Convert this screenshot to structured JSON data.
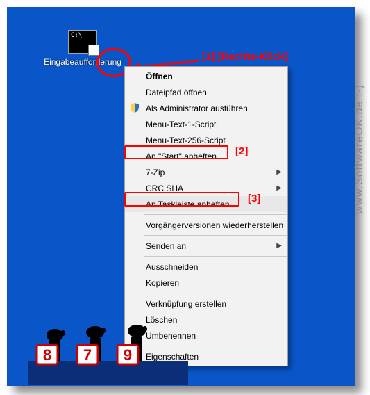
{
  "desktop_icon": {
    "prompt_text": "C:\\_",
    "label": "Eingabeaufforderung"
  },
  "menu": {
    "open": "Öffnen",
    "open_file_location": "Dateipfad öffnen",
    "run_as_admin": "Als Administrator ausführen",
    "menu_text_1": "Menu-Text-1-Script",
    "menu_text_256": "Menu-Text-256-Script",
    "pin_to_start": "An \"Start\" anheften",
    "seven_zip": "7-Zip",
    "crc_sha": "CRC SHA",
    "pin_to_taskbar": "An Taskleiste anheften",
    "previous_versions": "Vorgängerversionen wiederherstellen",
    "send_to": "Senden an",
    "cut": "Ausschneiden",
    "copy": "Kopieren",
    "create_shortcut": "Verknüpfung erstellen",
    "delete": "Löschen",
    "rename": "Umbenennen",
    "properties": "Eigenschaften"
  },
  "annotations": {
    "a1": "[1] [Rechts-Klick]",
    "a2": "[2]",
    "a3": "[3]"
  },
  "judges": {
    "n1": "8",
    "n2": "7",
    "n3": "9"
  },
  "watermark": "www.SoftwareOK.de :-)"
}
